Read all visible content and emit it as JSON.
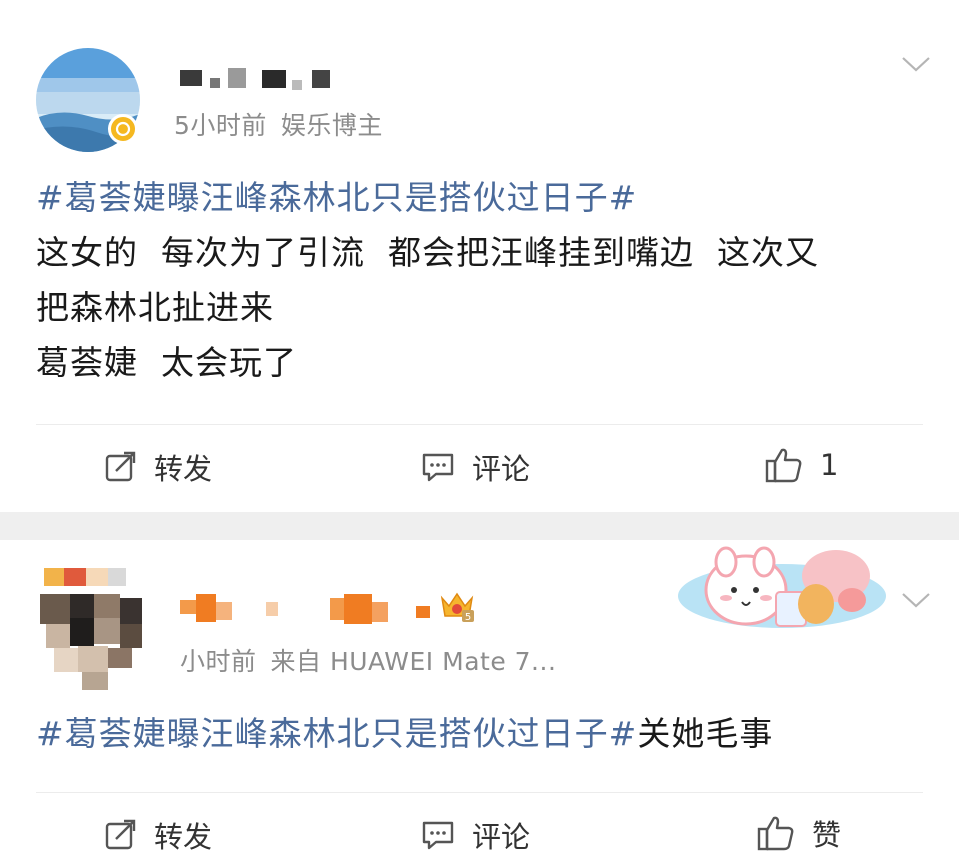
{
  "posts": [
    {
      "meta_time": "5小时前",
      "meta_tag": "娱乐博主",
      "hashtag": "#葛荟婕曝汪峰森林北只是搭伙过日子#",
      "lines": [
        "这女的  每次为了引流  都会把汪峰挂到嘴边  这次又",
        "把森林北扯进来",
        "葛荟婕  太会玩了"
      ],
      "actions": {
        "repost": "转发",
        "comment": "评论",
        "like": "1"
      }
    },
    {
      "meta_time": "小时前",
      "meta_source": "来自 HUAWEI Mate 7...",
      "hashtag": "#葛荟婕曝汪峰森林北只是搭伙过日子#",
      "tail": "关她毛事",
      "badge_level": "5",
      "actions": {
        "repost": "转发",
        "comment": "评论",
        "like": "赞"
      }
    }
  ],
  "icons": {
    "repost": "repost-icon",
    "comment": "comment-icon",
    "like": "thumbs-up-icon",
    "more": "chevron-down-icon",
    "verified": "verified-badge-icon",
    "vip": "crown-badge-icon"
  },
  "colors": {
    "hashtag": "#4a6a9a",
    "meta": "#8c8c8c",
    "verified": "#f5b820"
  }
}
